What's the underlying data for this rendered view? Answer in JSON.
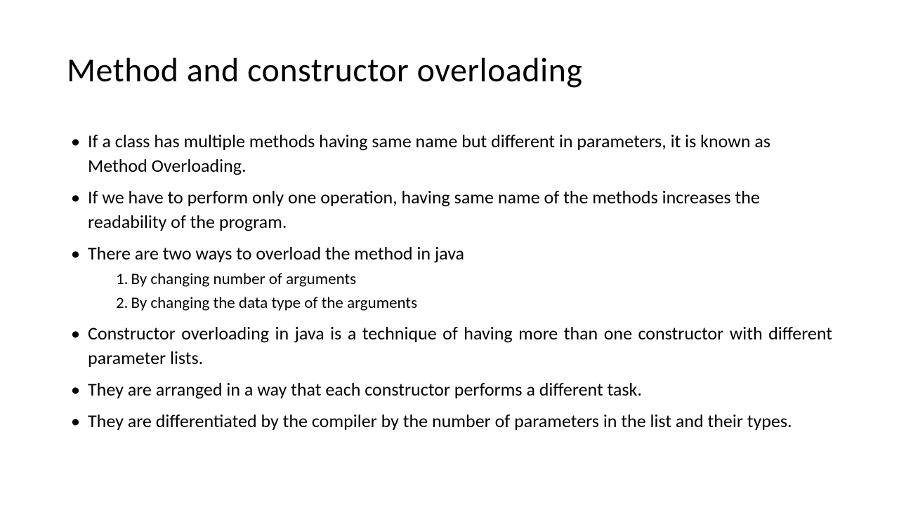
{
  "title": "Method and constructor overloading",
  "bullets": {
    "b1": "If a class has multiple methods having same name but different in parameters, it is known as Method Overloading.",
    "b2": "If we have to perform only one operation, having same name of the methods increases the readability of the program.",
    "b3": "There are two ways to overload the method in java",
    "b4": "Constructor overloading in java is a technique of having more than one constructor with different parameter lists.",
    "b5": "They are arranged in a way that each constructor performs a different task.",
    "b6": "They are differentiated by the compiler by the number of parameters in the list and their types."
  },
  "sublist": {
    "n1": "1.",
    "s1": "By changing number of arguments",
    "n2": "2.",
    "s2": "By changing the data type of the arguments"
  }
}
